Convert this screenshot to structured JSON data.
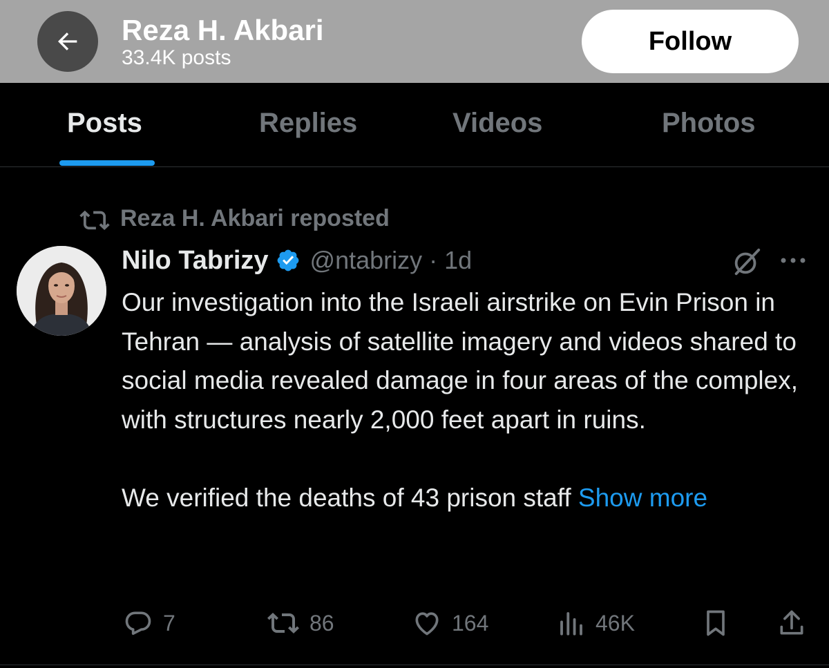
{
  "header": {
    "name": "Reza H. Akbari",
    "post_count": "33.4K posts",
    "follow_label": "Follow",
    "back_icon": "arrow-left-icon"
  },
  "tabs": [
    {
      "label": "Posts",
      "active": true
    },
    {
      "label": "Replies",
      "active": false
    },
    {
      "label": "Videos",
      "active": false
    },
    {
      "label": "Photos",
      "active": false
    }
  ],
  "post": {
    "repost_label": "Reza H. Akbari reposted",
    "author_name": "Nilo Tabrizy",
    "handle_time": "@ntabrizy · 1d",
    "verified": true,
    "paragraph1": "Our investigation into the Israeli airstrike on Evin Prison in Tehran — analysis of satellite imagery and videos shared to social media revealed damage in four areas of the complex, with structures nearly 2,000 feet apart in ruins.",
    "paragraph2": "We verified the deaths of 43 prison staff",
    "show_more": "Show more",
    "actions": {
      "replies": "7",
      "reposts": "86",
      "likes": "164",
      "views": "46K"
    }
  },
  "colors": {
    "accent": "#1d9bf0",
    "muted": "#71767b",
    "header_bg": "#a5a5a5"
  }
}
